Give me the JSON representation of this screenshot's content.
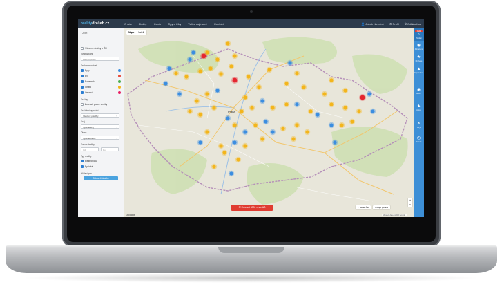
{
  "topbar": {
    "logo_a": "reality",
    "logo_b": "dražeb.cz",
    "nav": [
      "O nás",
      "Služby",
      "Ceník",
      "Tipy a triky",
      "Velice zajímavé",
      "Kontakt"
    ],
    "user_name": "Jakub Novotný",
    "profile": "Profil",
    "logout": "Odhlásit se"
  },
  "sidebar": {
    "back": "Zpět",
    "all_label": "Všechny dražby v ČR",
    "search_label": "Vyhledávání",
    "search_placeholder": "Zadejte pojem",
    "types_label": "Druh nemovitosti",
    "types": [
      {
        "label": "Byty",
        "color": "#3b8de0"
      },
      {
        "label": "Byt",
        "color": "#e84b3c"
      },
      {
        "label": "Pozemek",
        "color": "#4caf50"
      },
      {
        "label": "Chata",
        "color": "#f3b51b"
      },
      {
        "label": "Ostatní",
        "color": "#e91e63"
      }
    ],
    "auctions_label": "Dražby",
    "auctions_only": "Zobrazit pouze ceníky",
    "price_label": "Dražební vyvolání",
    "price_select": "Všechny položky",
    "region_label": "Kraj",
    "region_select": "Vyberte kraj",
    "district_label": "Okres",
    "district_select": "Vyberte okres",
    "date_label": "Datum dražby",
    "date_from": "Od",
    "date_to": "Do",
    "kind_label": "Typ dražby",
    "kinds": [
      "Elektronická",
      "Fyzická"
    ],
    "more_label": "Hlídací pes",
    "button": "Zobrazit dražby",
    "button2": "Zobrazit dražby"
  },
  "map": {
    "type_map": "Mapa",
    "type_sat": "Satelit",
    "cta": "Zobrazit 3000 výsledků",
    "ctl_a": "Vedle ČR",
    "ctl_b": "Moje poloha",
    "attribution": "Mapová data ©2015 Google",
    "google": "Google",
    "city_1": "Praha",
    "markers": {
      "blue": "#3b8de0",
      "yellow": "#f3b51b",
      "red": "#e5262f"
    }
  },
  "rightbar": {
    "badge": "NEW",
    "items": [
      {
        "icon": "search-icon",
        "glyph": "🔍",
        "label": "Hledání"
      },
      {
        "icon": "eye-icon",
        "glyph": "◉",
        "label": "Zobrazeno"
      },
      {
        "icon": "star-icon",
        "glyph": "★",
        "label": "Oblíbené"
      },
      {
        "icon": "thumb-icon",
        "glyph": "👍",
        "label": "Doporučené"
      },
      {
        "icon": "eye-icon",
        "glyph": "◉",
        "label": "Aktivní"
      },
      {
        "icon": "horse-icon",
        "glyph": "♞",
        "label": "Aukce"
      },
      {
        "icon": "close-icon",
        "glyph": "✕",
        "label": "Skrýt"
      },
      {
        "icon": "clock-icon",
        "glyph": "◷",
        "label": "Historie"
      }
    ]
  }
}
